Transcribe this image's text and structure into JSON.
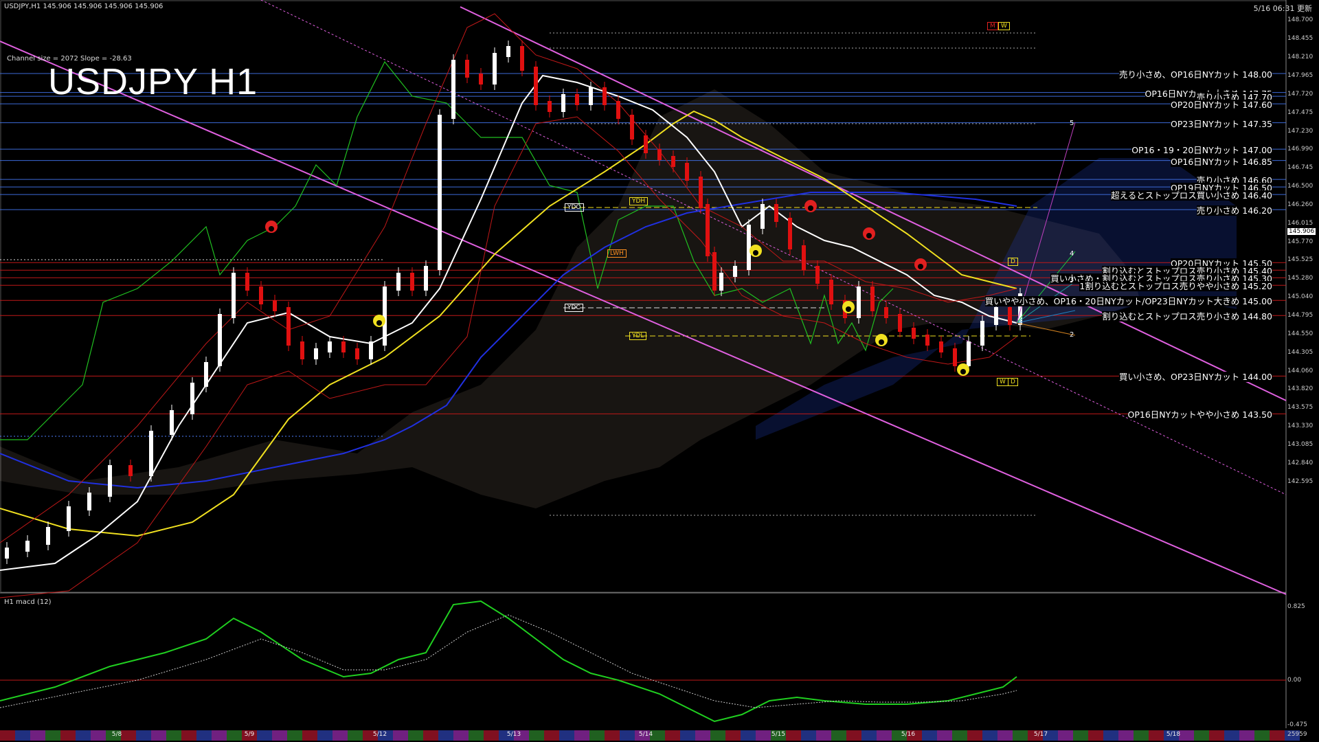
{
  "header": {
    "symbol_info": "USDJPY,H1 145.906 145.906 145.906 145.906",
    "timestamp": "5/16 06:31 更新",
    "channel_info": "Channel size = 2072 Slope = -28.63",
    "title": "USDJPY H1",
    "macd_label": "H1 macd (12)"
  },
  "price_axis": {
    "labels": [
      "148.700",
      "148.455",
      "148.210",
      "147.965",
      "147.720",
      "147.475",
      "147.230",
      "146.990",
      "146.745",
      "146.500",
      "146.260",
      "146.015",
      "145.770",
      "145.525",
      "145.280",
      "145.040",
      "144.795",
      "144.550",
      "144.305",
      "144.060",
      "143.820",
      "143.575",
      "143.330",
      "143.085",
      "142.840",
      "142.595"
    ],
    "current": "145.906",
    "macd_labels": [
      "0.825",
      "0.00",
      "-0.475"
    ],
    "macd_bottom": "25959"
  },
  "levels": [
    {
      "price": "148.00",
      "text": "売り小さめ、OP16日NYカット 148.00"
    },
    {
      "price": "147.75",
      "text": "OP16日NYカット大きめ 147.75"
    },
    {
      "price": "147.70",
      "text": "売り小さめ 147.70"
    },
    {
      "price": "147.60",
      "text": "OP20日NYカット 147.60"
    },
    {
      "price": "147.35",
      "text": "OP23日NYカット 147.35"
    },
    {
      "price": "147.00",
      "text": "OP16・19・20日NYカット 147.00"
    },
    {
      "price": "146.85",
      "text": "OP16日NYカット 146.85"
    },
    {
      "price": "146.60",
      "text": "売り小さめ 146.60"
    },
    {
      "price": "146.50",
      "text": "OP19日NYカット 146.50"
    },
    {
      "price": "146.40",
      "text": "超えるとストップロス買い小さめ 146.40"
    },
    {
      "price": "146.20",
      "text": "売り小さめ 146.20"
    },
    {
      "price": "145.50",
      "text": "OP20日NYカット 145.50"
    },
    {
      "price": "145.40",
      "text": "割り込むとストップロス売り小さめ 145.40"
    },
    {
      "price": "145.30",
      "text": "買い小さめ・割り込むとストップロス売り小さめ 145.30"
    },
    {
      "price": "145.20",
      "text": "1割り込むとストップロス売りやや小さめ 145.20"
    },
    {
      "price": "145.00",
      "text": "買いやや小さめ、OP16・20日NYカット/OP23日NYカット大きめ 145.00"
    },
    {
      "price": "144.80",
      "text": "割り込むとストップロス売り小さめ 144.80"
    },
    {
      "price": "144.00",
      "text": "買い小さめ、OP23日NYカット 144.00"
    },
    {
      "price": "143.50",
      "text": "OP16日NYカットやや小さめ 143.50"
    }
  ],
  "dates": [
    "5/8",
    "5/9",
    "5/12",
    "5/13",
    "5/14",
    "5/15",
    "5/16",
    "5/17",
    "5/18"
  ],
  "markers": {
    "ydo": "YDO",
    "ydh": "YDH",
    "ydc": "YDC",
    "ydl": "YDL",
    "lwh": "LWH",
    "m": "M",
    "w": "W",
    "d": "D",
    "wd_w": "W",
    "wd_d": "D"
  },
  "waves": [
    "5",
    "4",
    "3",
    "2"
  ],
  "colors": {
    "background": "#000000",
    "level_blue": "#3c6ad8",
    "level_red": "#c01818",
    "channel": "#e060e0",
    "candle_up": "#ffffff",
    "candle_down": "#e01010",
    "ma_white": "#ffffff",
    "ma_yellow": "#f0e020",
    "ma_blue": "#2030e0",
    "chikou": "#20c020",
    "macd_green": "#20d020",
    "macd_pink": "#ff8090"
  }
}
